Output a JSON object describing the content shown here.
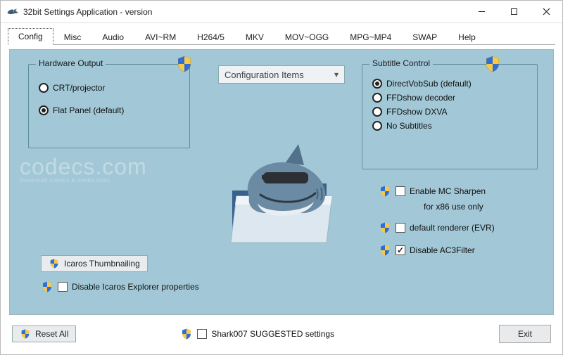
{
  "window": {
    "title": "32bit Settings Application - version"
  },
  "tabs": [
    "Config",
    "Misc",
    "Audio",
    "AVI~RM",
    "H264/5",
    "MKV",
    "MOV~OGG",
    "MPG~MP4",
    "SWAP",
    "Help"
  ],
  "active_tab_index": 0,
  "dropdown": {
    "label": "Configuration Items"
  },
  "hardware_output": {
    "legend": "Hardware Output",
    "options": [
      {
        "label": "CRT/projector",
        "selected": false
      },
      {
        "label": "Flat Panel (default)",
        "selected": true
      }
    ]
  },
  "subtitle_control": {
    "legend": "Subtitle Control",
    "options": [
      {
        "label": "DirectVobSub (default)",
        "selected": true
      },
      {
        "label": "FFDshow decoder",
        "selected": false
      },
      {
        "label": "FFDshow DXVA",
        "selected": false
      },
      {
        "label": "No Subtitles",
        "selected": false
      }
    ]
  },
  "icaros": {
    "button": "Icaros Thumbnailing",
    "disable_explorer": {
      "label": "Disable Icaros Explorer properties",
      "checked": false
    }
  },
  "right_checks": {
    "mc_sharpen": {
      "label": "Enable MC Sharpen",
      "sub": "for x86 use only",
      "checked": false
    },
    "default_renderer": {
      "label": "default renderer (EVR)",
      "checked": false
    },
    "disable_ac3": {
      "label": "Disable AC3Filter",
      "checked": true
    }
  },
  "footer": {
    "reset": "Reset All",
    "suggested": {
      "label": "Shark007 SUGGESTED settings",
      "checked": false
    },
    "exit": "Exit"
  },
  "watermark": {
    "main": "codecs.com",
    "sub": "Download codecs & media tools"
  }
}
